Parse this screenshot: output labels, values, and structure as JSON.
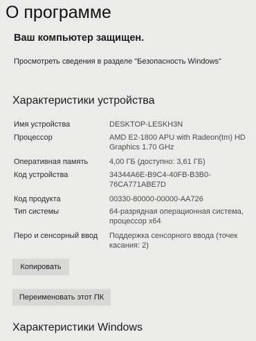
{
  "page_title": "О программе",
  "protection_status": "Ваш компьютер защищен.",
  "security_link": "Просмотреть сведения в разделе \"Безопасность Windows\"",
  "device_specs": {
    "header": "Характеристики устройства",
    "rows": [
      {
        "label": "Имя устройства",
        "value": "DESKTOP-LESKH3N"
      },
      {
        "label": "Процессор",
        "value": "AMD E2-1800 APU with Radeon(tm) HD Graphics   1.70 GHz"
      },
      {
        "label": "Оперативная память",
        "value": "4,00 ГБ (доступно: 3,61 ГБ)"
      },
      {
        "label": "Код устройства",
        "value": "34344A6E-B9C4-40FB-B3B0-76CA771ABE7D"
      },
      {
        "label": "Код продукта",
        "value": "00330-80000-00000-AA726"
      },
      {
        "label": "Тип системы",
        "value": "64-разрядная операционная система, процессор x64"
      },
      {
        "label": "Перо и сенсорный ввод",
        "value": "Поддержка сенсорного ввода (точек касания: 2)"
      }
    ]
  },
  "buttons": {
    "copy": "Копировать",
    "rename": "Переименовать этот ПК"
  },
  "windows_specs": {
    "header": "Характеристики Windows"
  }
}
